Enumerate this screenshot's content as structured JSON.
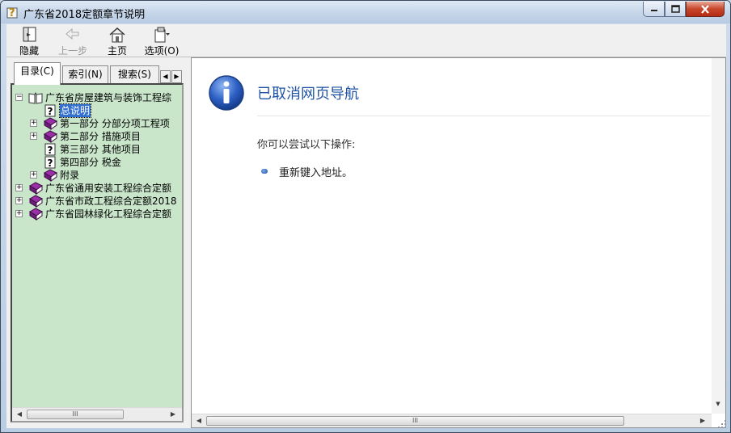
{
  "window": {
    "title": "广东省2018定额章节说明",
    "icons": {
      "app": "help-file-icon",
      "minimize": "minimize-icon",
      "maximize": "maximize-icon",
      "close": "close-icon"
    }
  },
  "toolbar": {
    "buttons": [
      {
        "label": "隐藏",
        "icon": "hide-pane-icon",
        "enabled": true
      },
      {
        "label": "上一步",
        "icon": "back-arrow-icon",
        "enabled": false
      },
      {
        "label": "主页",
        "icon": "home-icon",
        "enabled": true
      },
      {
        "label": "选项(O)",
        "icon": "options-icon",
        "enabled": true
      }
    ]
  },
  "navigation": {
    "tabs": [
      {
        "label": "目录(C)",
        "active": true
      },
      {
        "label": "索引(N)",
        "active": false
      },
      {
        "label": "搜索(S)",
        "active": false
      }
    ],
    "tree": [
      {
        "label": "广东省房屋建筑与装饰工程综",
        "icon": "open-book-icon",
        "expander": "−",
        "level": 0
      },
      {
        "label": "总说明",
        "icon": "help-page-icon",
        "expander": "",
        "level": 1,
        "selected": true
      },
      {
        "label": "第一部分  分部分项工程项",
        "icon": "closed-book-icon",
        "expander": "+",
        "level": 1
      },
      {
        "label": "第二部分  措施项目",
        "icon": "closed-book-icon",
        "expander": "+",
        "level": 1
      },
      {
        "label": "第三部分  其他项目",
        "icon": "help-page-icon",
        "expander": "",
        "level": 1
      },
      {
        "label": "第四部分  税金",
        "icon": "help-page-icon",
        "expander": "",
        "level": 1
      },
      {
        "label": "附录",
        "icon": "closed-book-icon",
        "expander": "+",
        "level": 1
      },
      {
        "label": "广东省通用安装工程综合定额",
        "icon": "closed-book-icon",
        "expander": "+",
        "level": 0
      },
      {
        "label": "广东省市政工程综合定额2018",
        "icon": "closed-book-icon",
        "expander": "+",
        "level": 0
      },
      {
        "label": "广东省园林绿化工程综合定额",
        "icon": "closed-book-icon",
        "expander": "+",
        "level": 0
      }
    ]
  },
  "content": {
    "icon": "info-icon",
    "title": "已取消网页导航",
    "subtitle": "你可以尝试以下操作:",
    "bullets": [
      "重新键入地址。"
    ]
  },
  "colors": {
    "tree_background": "#c9e6cb",
    "title_blue": "#1f53a4",
    "selection": "#3470d0"
  }
}
